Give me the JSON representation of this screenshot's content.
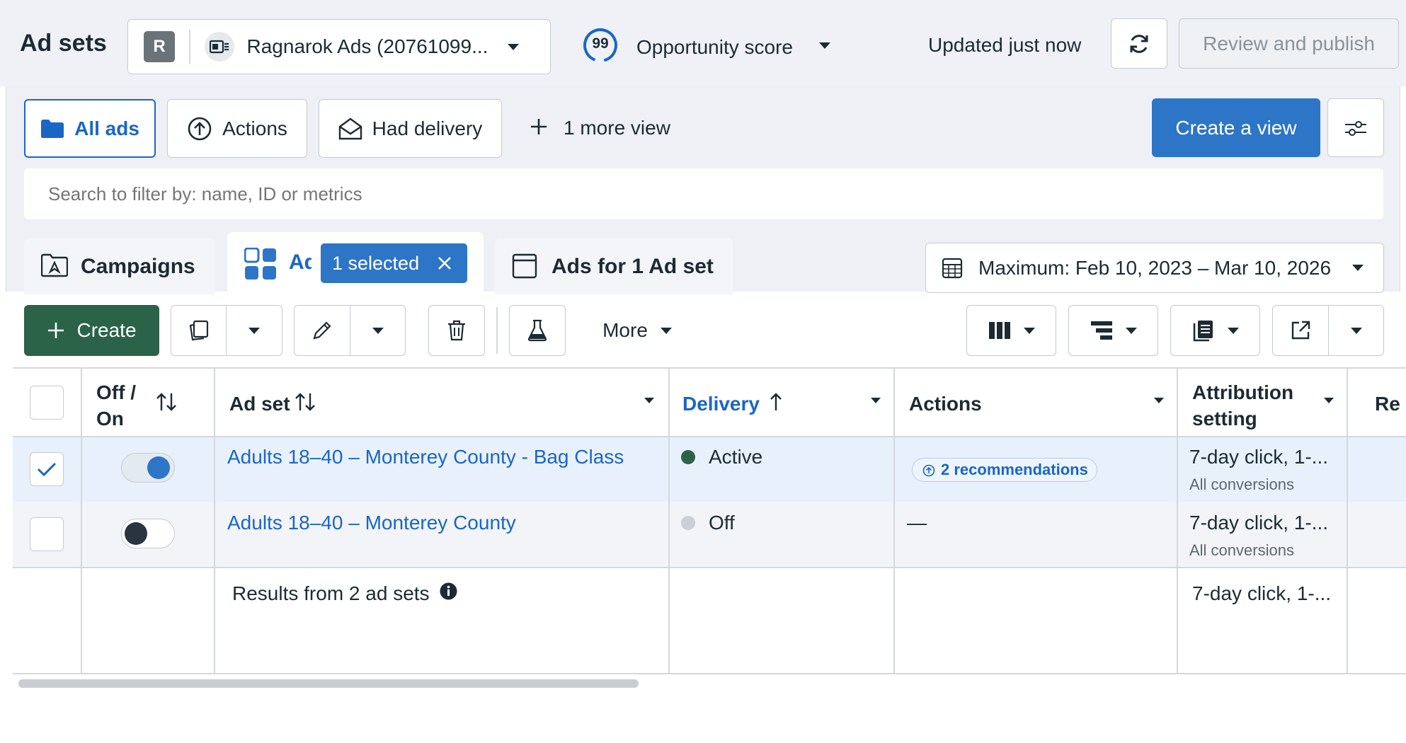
{
  "colors": {
    "accent_blue": "#1a66c7",
    "primary_button": "#2d75c6",
    "create_green": "#2b6349",
    "active_green": "#2b6349",
    "off_gray": "#cbd0d6",
    "selected_row": "#e8f1fb"
  },
  "header": {
    "title": "Ad sets",
    "account_initial": "R",
    "account_name": "Ragnarok Ads (20761099...",
    "opportunity_score_value": "99",
    "opportunity_score_label": "Opportunity score",
    "updated_text": "Updated just now",
    "review_publish_label": "Review and publish"
  },
  "views": {
    "all_ads_label": "All ads",
    "actions_label": "Actions",
    "had_delivery_label": "Had delivery",
    "more_view_label": "1 more view",
    "create_view_label": "Create a view"
  },
  "search": {
    "placeholder": "Search to filter by: name, ID or metrics"
  },
  "tabs": {
    "campaigns_label": "Campaigns",
    "adsets_label_partial": "Ad",
    "selected_chip_label": "1 selected",
    "ads_label": "Ads for 1 Ad set"
  },
  "date_range": {
    "label": "Maximum: Feb 10, 2023 – Mar 10, 2026"
  },
  "toolbar": {
    "create_label": "Create",
    "more_label": "More"
  },
  "table": {
    "columns": {
      "off_on": "Off /\nOn",
      "ad_set": "Ad set",
      "delivery": "Delivery",
      "actions": "Actions",
      "attribution": "Attribution\nsetting",
      "results_partial": "Re"
    },
    "rows": [
      {
        "name": "Adults 18–40 – Monterey County - Bag Class",
        "checked": true,
        "on": true,
        "delivery": "Active",
        "actions": "2 recommendations",
        "attribution": "7-day click, 1-...",
        "attribution_sub": "All conversions"
      },
      {
        "name": "Adults 18–40 – Monterey County",
        "checked": false,
        "on": false,
        "delivery": "Off",
        "actions": "—",
        "attribution": "7-day click, 1-...",
        "attribution_sub": "All conversions"
      }
    ],
    "summary": {
      "label": "Results from 2 ad sets",
      "attribution": "7-day click, 1-..."
    }
  }
}
